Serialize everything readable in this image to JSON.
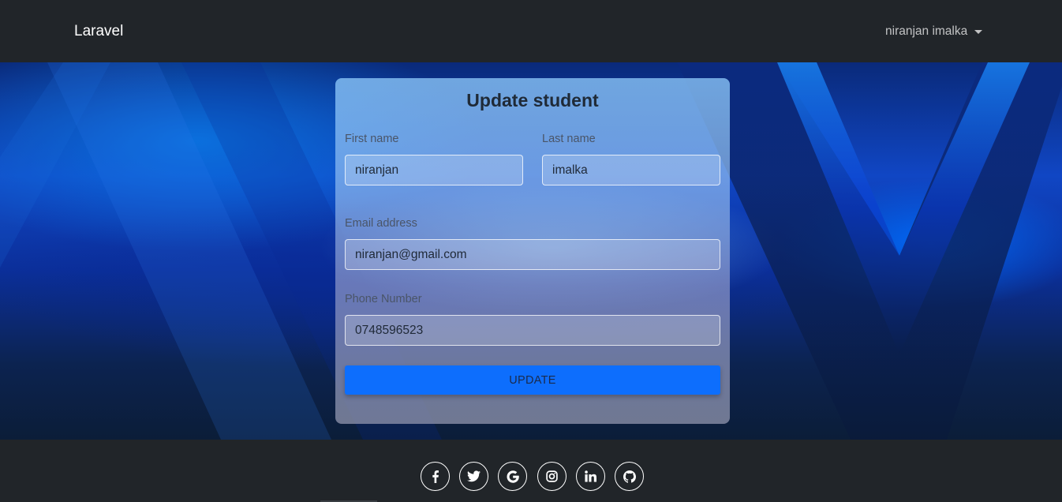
{
  "navbar": {
    "brand": "Laravel",
    "user_name": "niranjan imalka"
  },
  "form": {
    "title": "Update student",
    "first_name": {
      "label": "First name",
      "value": "niranjan"
    },
    "last_name": {
      "label": "Last name",
      "value": "imalka"
    },
    "email": {
      "label": "Email address",
      "value": "niranjan@gmail.com"
    },
    "phone": {
      "label": "Phone Number",
      "value": "0748596523"
    },
    "submit_label": "UPDATE"
  },
  "footer": {
    "social_links": [
      "facebook-icon",
      "twitter-icon",
      "google-icon",
      "instagram-icon",
      "linkedin-icon",
      "github-icon"
    ]
  },
  "colors": {
    "navbar_bg": "#212529",
    "button_primary": "#0d6efd"
  }
}
